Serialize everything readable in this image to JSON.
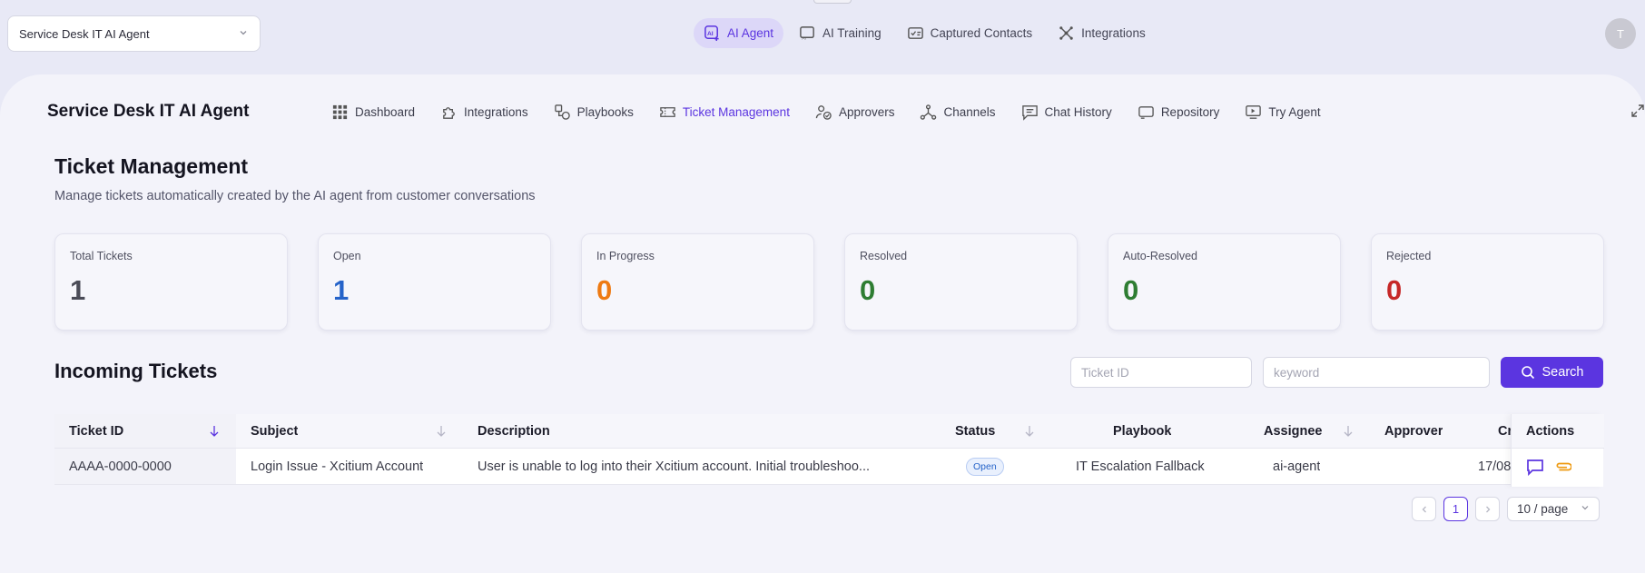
{
  "agent_select": {
    "value": "Service Desk IT AI Agent"
  },
  "top_nav": [
    {
      "label": "AI Agent",
      "icon": "ai-agent-icon",
      "active": true
    },
    {
      "label": "AI Training",
      "icon": "ai-training-icon"
    },
    {
      "label": "Captured Contacts",
      "icon": "contacts-icon"
    },
    {
      "label": "Integrations",
      "icon": "integrations-icon"
    }
  ],
  "avatar_initial": "T",
  "agent_title": "Service Desk IT AI Agent",
  "sub_nav": [
    {
      "label": "Dashboard",
      "icon": "grid-icon"
    },
    {
      "label": "Integrations",
      "icon": "puzzle-icon"
    },
    {
      "label": "Playbooks",
      "icon": "shapes-icon"
    },
    {
      "label": "Ticket Management",
      "icon": "ticket-icon",
      "active": true
    },
    {
      "label": "Approvers",
      "icon": "approvers-icon"
    },
    {
      "label": "Channels",
      "icon": "channels-icon"
    },
    {
      "label": "Chat History",
      "icon": "chat-icon"
    },
    {
      "label": "Repository",
      "icon": "repository-icon"
    },
    {
      "label": "Try Agent",
      "icon": "try-agent-icon"
    }
  ],
  "page": {
    "title": "Ticket Management",
    "subtitle": "Manage tickets automatically created by the AI agent from customer conversations"
  },
  "stats": [
    {
      "label": "Total Tickets",
      "value": "1",
      "color": "#4a4b57"
    },
    {
      "label": "Open",
      "value": "1",
      "color": "#2563c9"
    },
    {
      "label": "In Progress",
      "value": "0",
      "color": "#ee7a12"
    },
    {
      "label": "Resolved",
      "value": "0",
      "color": "#2e7d32"
    },
    {
      "label": "Auto-Resolved",
      "value": "0",
      "color": "#2e7d32"
    },
    {
      "label": "Rejected",
      "value": "0",
      "color": "#c62828"
    }
  ],
  "incoming": {
    "title": "Incoming Tickets",
    "ticket_id_placeholder": "Ticket ID",
    "keyword_placeholder": "keyword",
    "search_label": "Search"
  },
  "table": {
    "headers": {
      "ticket_id": "Ticket ID",
      "subject": "Subject",
      "description": "Description",
      "status": "Status",
      "playbook": "Playbook",
      "assignee": "Assignee",
      "approver": "Approver",
      "created": "Cr",
      "actions": "Actions"
    },
    "rows": [
      {
        "ticket_id": "AAAA-0000-0000",
        "subject": "Login Issue - Xcitium Account",
        "description": "User is unable to log into their Xcitium account. Initial troubleshoo...",
        "status": "Open",
        "playbook": "IT Escalation Fallback",
        "assignee": "ai-agent",
        "approver": "",
        "created": "17/08,"
      }
    ]
  },
  "pagination": {
    "prev": "<",
    "current": "1",
    "next": ">",
    "page_size": "10 / page"
  }
}
